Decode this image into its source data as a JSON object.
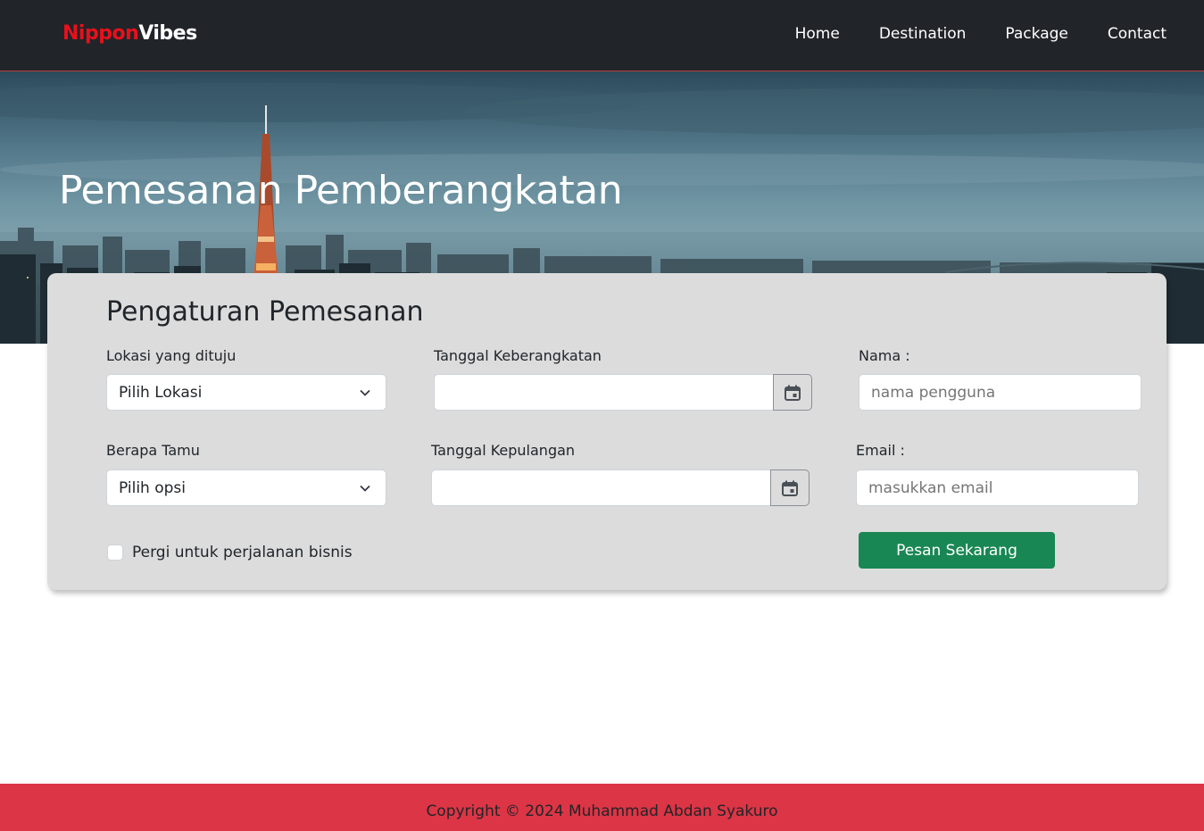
{
  "brand": {
    "part1": "Nippon",
    "part2": "Vibes",
    "accent": "#e8101b"
  },
  "nav": {
    "items": [
      "Home",
      "Destination",
      "Package",
      "Contact"
    ]
  },
  "hero": {
    "title": "Pemesanan Pemberangkatan"
  },
  "form": {
    "title": "Pengaturan Pemesanan",
    "location": {
      "label": "Lokasi yang dituju",
      "value": "Pilih Lokasi"
    },
    "guests": {
      "label": "Berapa Tamu",
      "value": "Pilih opsi"
    },
    "departure": {
      "label": "Tanggal Keberangkatan",
      "value": ""
    },
    "return": {
      "label": "Tanggal Kepulangan",
      "value": ""
    },
    "name": {
      "label": "Nama :",
      "placeholder": "nama pengguna"
    },
    "email": {
      "label": "Email :",
      "placeholder": "masukkan email"
    },
    "business": {
      "label": "Pergi untuk perjalanan bisnis",
      "checked": false
    },
    "submit_label": "Pesan Sekarang",
    "submit_color": "#198754"
  },
  "footer": {
    "text": "Copyright © 2024 Muhammad Abdan Syakuro",
    "color": "#dc3545"
  },
  "icons": {
    "date": "calendar-icon",
    "select": "chevron-down-icon"
  }
}
